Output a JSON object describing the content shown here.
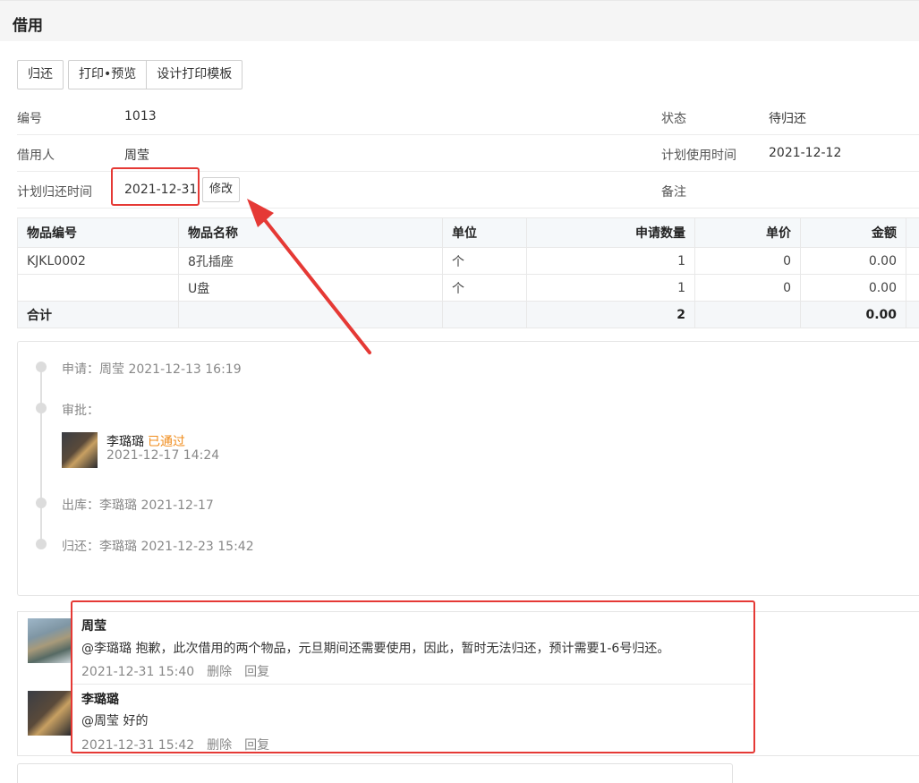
{
  "page": {
    "title": "借用"
  },
  "toolbar": {
    "return_label": "归还",
    "print_preview_label": "打印•预览",
    "design_template_label": "设计打印模板"
  },
  "info": {
    "number_label": "编号",
    "number_value": "1013",
    "status_label": "状态",
    "status_value": "待归还",
    "borrower_label": "借用人",
    "borrower_value": "周莹",
    "plan_use_label": "计划使用时间",
    "plan_use_value": "2021-12-12",
    "plan_return_label": "计划归还时间",
    "plan_return_value": "2021-12-31",
    "edit_label": "修改",
    "remark_label": "备注"
  },
  "items_table": {
    "headers": [
      "物品编号",
      "物品名称",
      "单位",
      "申请数量",
      "单价",
      "金额"
    ],
    "rows": [
      [
        "KJKL0002",
        "8孔插座",
        "个",
        "1",
        "0",
        "0.00"
      ],
      [
        "",
        "U盘",
        "个",
        "1",
        "0",
        "0.00"
      ]
    ],
    "total": {
      "label": "合计",
      "quantity": "2",
      "amount": "0.00"
    }
  },
  "timeline": {
    "apply": "申请：周莹 2021-12-13 16:19",
    "approve_label": "审批：",
    "approver_name": "李璐璐",
    "approver_status": "已通过",
    "approver_time": "2021-12-17 14:24",
    "outbound": "出库：李璐璐 2021-12-17",
    "returned": "归还：李璐璐 2021-12-23 15:42"
  },
  "comments": [
    {
      "author": "周莹",
      "text": "@李璐璐 抱歉，此次借用的两个物品，元旦期间还需要使用，因此，暂时无法归还，预计需要1-6号归还。",
      "time": "2021-12-31 15:40",
      "delete_label": "删除",
      "reply_label": "回复"
    },
    {
      "author": "李璐璐",
      "text": "@周莹 好的",
      "time": "2021-12-31 15:42",
      "delete_label": "删除",
      "reply_label": "回复"
    }
  ],
  "colors": {
    "approved": "#f08c1c",
    "highlight": "#e53935"
  }
}
